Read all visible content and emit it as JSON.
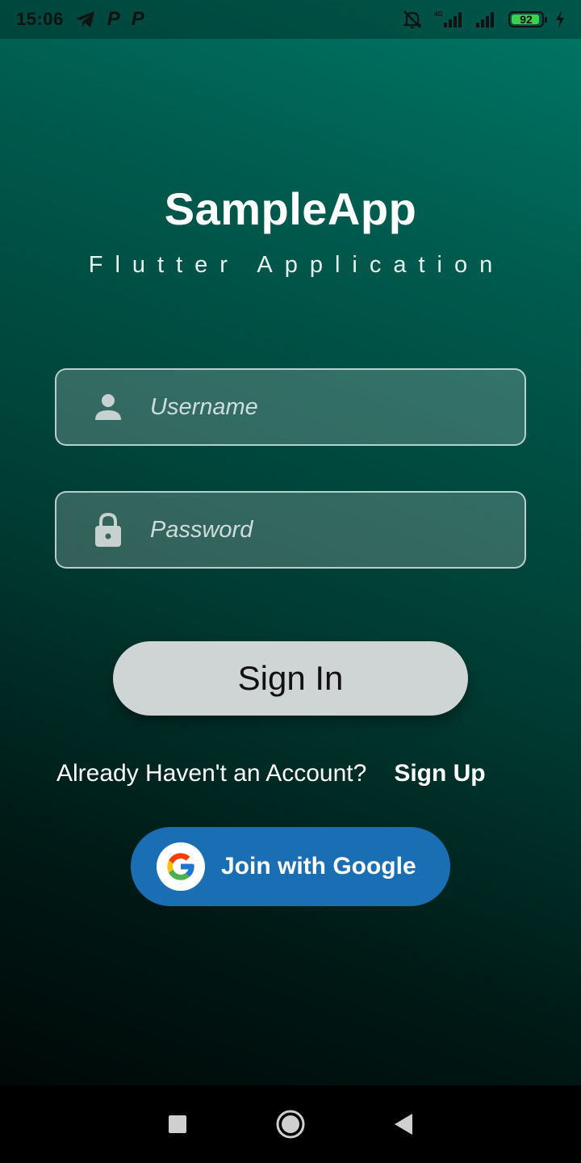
{
  "status_bar": {
    "time": "15:06",
    "notification_icons": [
      "telegram-icon",
      "p-icon",
      "p-icon"
    ],
    "p_glyph": "P",
    "right_icons": [
      "muted-bell-icon",
      "signal-4g-icon",
      "signal-icon"
    ],
    "battery_level": "92",
    "charging": true
  },
  "header": {
    "title": "SampleApp",
    "subtitle": "Flutter Application"
  },
  "form": {
    "username": {
      "placeholder": "Username",
      "value": "",
      "icon": "person-icon"
    },
    "password": {
      "placeholder": "Password",
      "value": "",
      "icon": "lock-icon"
    },
    "sign_in_label": "Sign In"
  },
  "account": {
    "prompt": "Already Haven't an Account?",
    "sign_up_label": "Sign Up"
  },
  "google": {
    "label": "Join with Google",
    "icon": "google-logo-icon"
  },
  "nav_bar": {
    "buttons": [
      "recents-square-icon",
      "home-circle-icon",
      "back-triangle-icon"
    ]
  },
  "colors": {
    "background_top": "#007766",
    "background_bottom": "#000807",
    "sign_in_button": "#cfd5d5",
    "google_button": "#1a6fb4",
    "battery_fill": "#3ecf4a"
  }
}
